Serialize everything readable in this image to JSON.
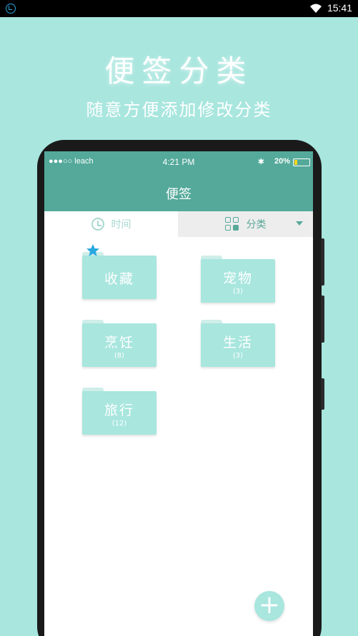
{
  "system_status": {
    "time": "15:41"
  },
  "promo": {
    "headline": "便签分类",
    "subline": "随意方便添加修改分类"
  },
  "ios_status": {
    "carrier": "●●●○○ leach",
    "time": "4:21 PM",
    "battery_pct": "20%",
    "battery_level": 0.2
  },
  "app": {
    "title": "便签"
  },
  "tabs": {
    "time_label": "时间",
    "category_label": "分类"
  },
  "folders": [
    {
      "name": "收藏",
      "count": ""
    },
    {
      "name": "宠物",
      "count": "(3)"
    },
    {
      "name": "烹饪",
      "count": "(8)"
    },
    {
      "name": "生活",
      "count": "(3)"
    },
    {
      "name": "旅行",
      "count": "(12)"
    }
  ],
  "fab": {
    "label": "+"
  },
  "colors": {
    "background": "#a8e6de",
    "appbar": "#54a99a",
    "accent": "#5aa899",
    "star": "#2aa8e0"
  },
  "icons": [
    "clock-icon",
    "grid-icon",
    "chevron-down-icon",
    "star-icon",
    "plus-icon",
    "wifi-icon",
    "bluetooth-icon",
    "battery-icon"
  ]
}
